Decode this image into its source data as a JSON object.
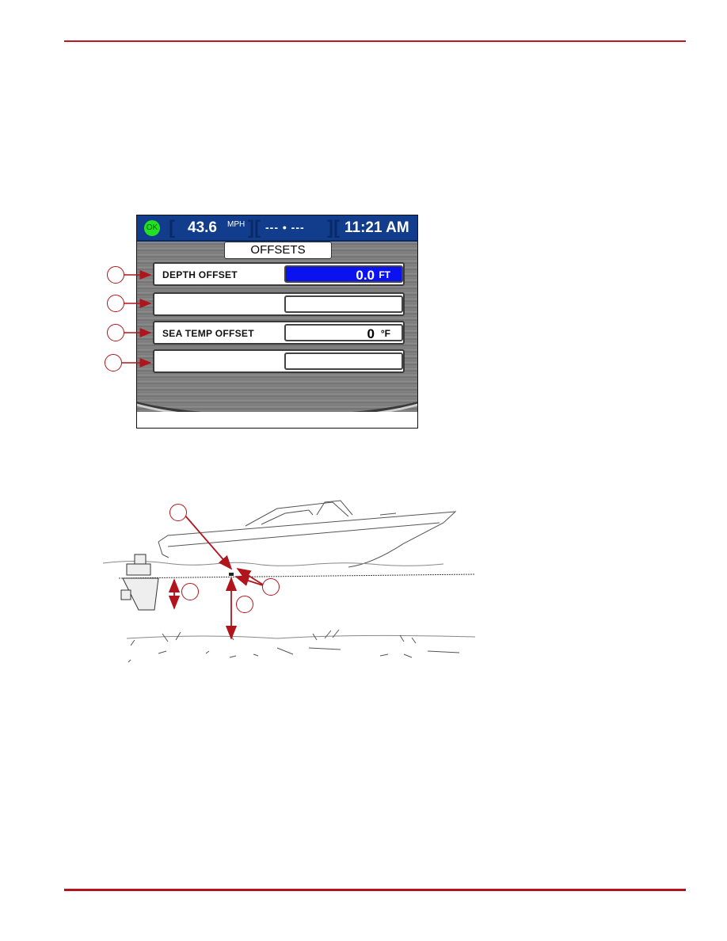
{
  "page": {
    "accent_color": "#c0161f"
  },
  "screen": {
    "status_badge": "OK",
    "speed_value": "43.6",
    "speed_unit": "MPH",
    "heading": "--- • ---",
    "clock": "11:21 AM",
    "title": "OFFSETS",
    "rows": [
      {
        "label": "DEPTH OFFSET",
        "value": "0.0",
        "unit": "FT",
        "selected": true
      },
      {
        "label": "",
        "value": "",
        "unit": "",
        "selected": false
      },
      {
        "label": "SEA TEMP OFFSET",
        "value": "0",
        "unit": "°F",
        "selected": false
      },
      {
        "label": "",
        "value": "",
        "unit": "",
        "selected": false
      }
    ],
    "colors": {
      "topbar": "#123c8c",
      "ok_badge": "#22e022",
      "selected_value": "#0a12f0"
    }
  },
  "illustration": {
    "subject": "boat-depth-transducer-diagram",
    "callouts": [
      "",
      "",
      "",
      ""
    ]
  }
}
